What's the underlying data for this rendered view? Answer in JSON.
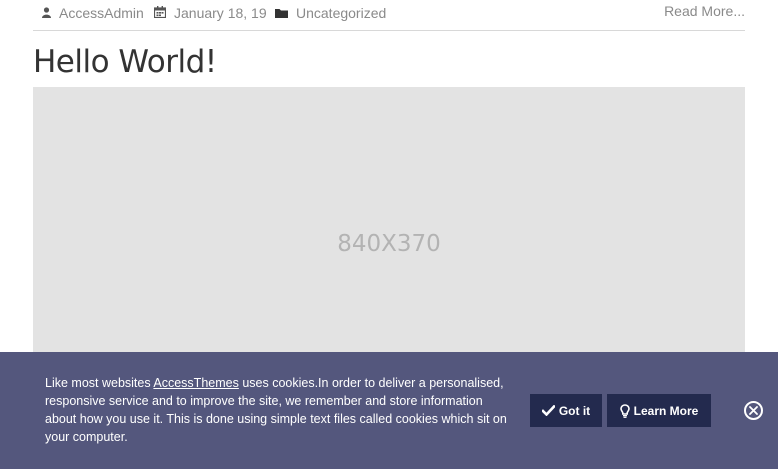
{
  "meta": {
    "author": "AccessAdmin",
    "date": "January 18, 19",
    "category": "Uncategorized",
    "read_more": "Read More...",
    "icons": [
      "user-icon",
      "calendar-icon",
      "folder-icon"
    ]
  },
  "post": {
    "title": "Hello World!",
    "placeholder_label": "840X370"
  },
  "cookie": {
    "text_before": "Like most websites ",
    "link": "AccessThemes",
    "text_after": " uses cookies.In order to deliver a personalised, responsive service and to improve the site, we remember and store information about how you use it. This is done using simple text files called cookies which sit on your computer.",
    "got_it": "Got it",
    "learn_more": "Learn More",
    "background_color": "#54577d",
    "button_color": "#232a4e"
  }
}
